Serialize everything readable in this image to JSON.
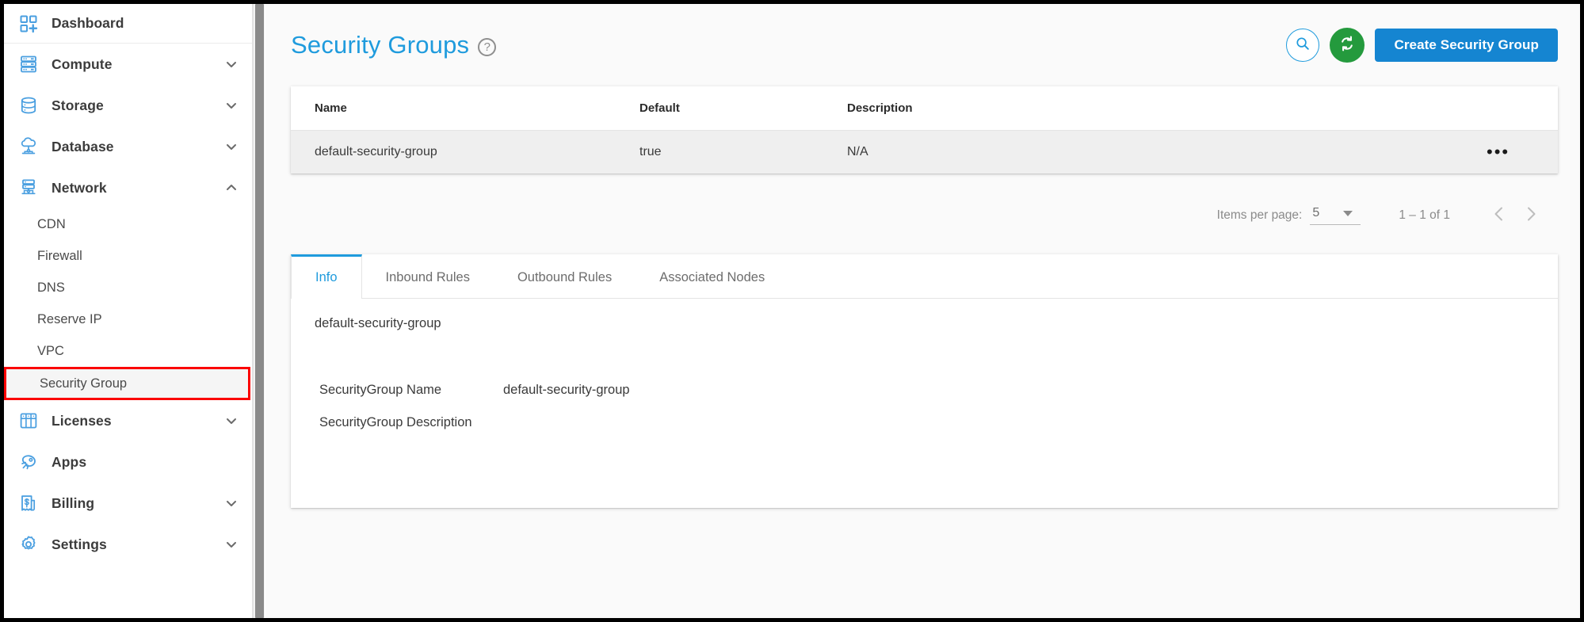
{
  "sidebar": {
    "dashboard": {
      "label": "Dashboard",
      "icon": "dashboard-add-icon"
    },
    "groups": [
      {
        "label": "Compute",
        "icon": "server-rack-icon",
        "chevron": "chevron-down-icon",
        "expanded": false
      },
      {
        "label": "Storage",
        "icon": "database-disk-icon",
        "chevron": "chevron-down-icon",
        "expanded": false
      },
      {
        "label": "Database",
        "icon": "cloud-database-icon",
        "chevron": "chevron-down-icon",
        "expanded": false
      },
      {
        "label": "Network",
        "icon": "network-node-icon",
        "chevron": "chevron-up-icon",
        "expanded": true
      }
    ],
    "network_items": [
      {
        "label": "CDN",
        "active": false
      },
      {
        "label": "Firewall",
        "active": false
      },
      {
        "label": "DNS",
        "active": false
      },
      {
        "label": "Reserve IP",
        "active": false
      },
      {
        "label": "VPC",
        "active": false
      },
      {
        "label": "Security Group",
        "active": true
      }
    ],
    "bottom_groups": [
      {
        "label": "Licenses",
        "icon": "license-grid-icon",
        "chevron": "chevron-down-icon"
      },
      {
        "label": "Apps",
        "icon": "rocket-icon",
        "chevron": ""
      },
      {
        "label": "Billing",
        "icon": "invoice-dollar-icon",
        "chevron": "chevron-down-icon"
      },
      {
        "label": "Settings",
        "icon": "gear-icon",
        "chevron": "chevron-down-icon"
      }
    ],
    "highlight_color": "#fb0000"
  },
  "header": {
    "title": "Security Groups",
    "help_icon": "help-question-icon",
    "search_icon": "search-icon",
    "refresh_icon": "refresh-icon",
    "create_label": "Create Security Group",
    "accent_color": "#1f9bdd",
    "primary_button_color": "#1585d1",
    "refresh_button_color": "#249a3d"
  },
  "table": {
    "columns": [
      "Name",
      "Default",
      "Description"
    ],
    "rows": [
      {
        "name": "default-security-group",
        "default": "true",
        "description": "N/A",
        "menu_icon": "more-options-icon"
      }
    ]
  },
  "paginator": {
    "items_per_page_label": "Items per page:",
    "items_per_page_value": "5",
    "dropdown_icon": "chevron-down-icon",
    "range_label": "1 – 1 of 1",
    "prev_icon": "chevron-left-icon",
    "next_icon": "chevron-right-icon"
  },
  "tabs": [
    {
      "label": "Info",
      "active": true
    },
    {
      "label": "Inbound Rules",
      "active": false
    },
    {
      "label": "Outbound Rules",
      "active": false
    },
    {
      "label": "Associated Nodes",
      "active": false
    }
  ],
  "info_panel": {
    "heading": "default-security-group",
    "fields": [
      {
        "key": "SecurityGroup Name",
        "value": "default-security-group"
      },
      {
        "key": "SecurityGroup Description",
        "value": ""
      }
    ]
  }
}
